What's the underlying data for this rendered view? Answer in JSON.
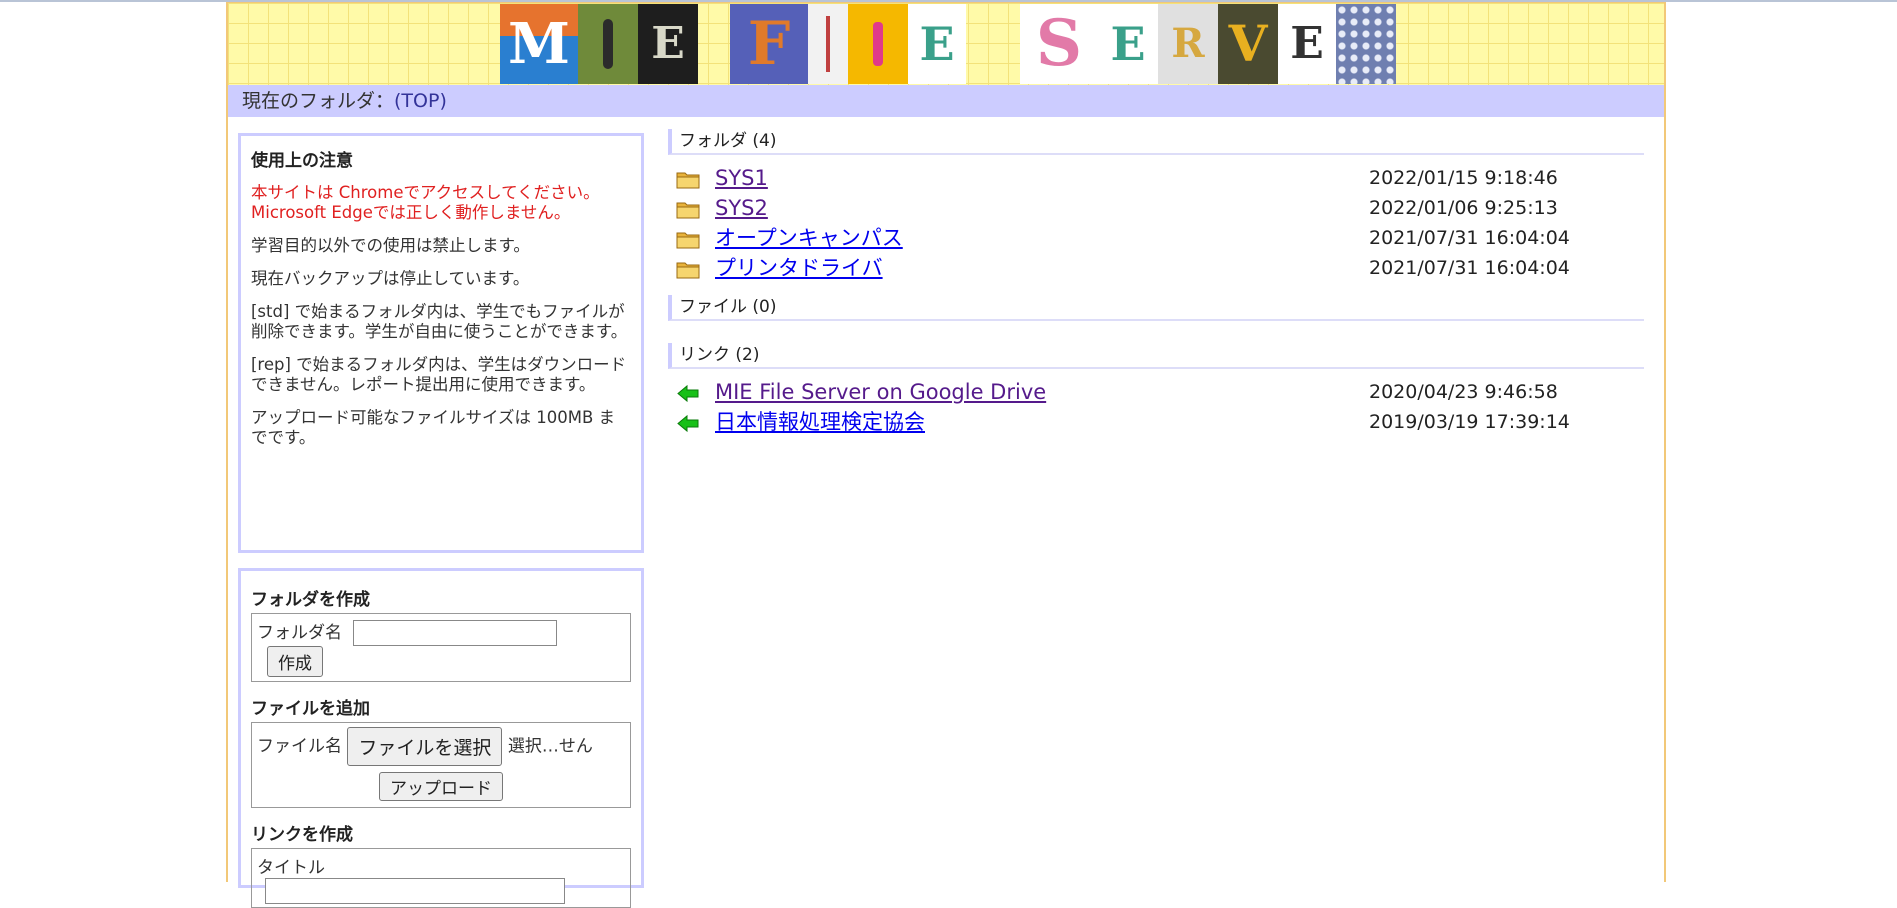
{
  "banner": {
    "tiles": [
      "M",
      "",
      "E",
      "F",
      "",
      "",
      "E",
      "S",
      "E",
      "R",
      "V",
      "E",
      ""
    ]
  },
  "path": {
    "label": "現在のフォルダ：",
    "current": "(TOP)"
  },
  "notes": {
    "title": "使用上の注意",
    "warning": "本サイトは Chromeでアクセスしてください。Microsoft Edgeでは正しく動作しません。",
    "lines": [
      "学習目的以外での使用は禁止します。",
      "現在バックアップは停止しています。",
      "[std] で始まるフォルダ内は、学生でもファイルが削除できます。学生が自由に使うことができます。",
      "[rep] で始まるフォルダ内は、学生はダウンロードできません。レポート提出用に使用できます。",
      "アップロード可能なファイルサイズは 100MB までです。"
    ]
  },
  "forms": {
    "create_folder": {
      "title": "フォルダを作成",
      "field_label": "フォルダ名",
      "value": "",
      "button": "作成"
    },
    "add_file": {
      "title": "ファイルを追加",
      "field_label": "ファイル名",
      "choose_button": "ファイルを選択",
      "status": "選択…せん",
      "upload_button": "アップロード"
    },
    "create_link": {
      "title": "リンクを作成",
      "title_label": "タイトル",
      "value": ""
    }
  },
  "sections": {
    "folders": {
      "label": "フォルダ",
      "count": "(4)"
    },
    "files": {
      "label": "ファイル",
      "count": "(0)"
    },
    "links": {
      "label": "リンク",
      "count": "(2)"
    }
  },
  "folders": [
    {
      "name": "SYS1",
      "date": "2022/01/15 9:18:46",
      "visited": true
    },
    {
      "name": "SYS2",
      "date": "2022/01/06 9:25:13",
      "visited": true
    },
    {
      "name": "オープンキャンパス",
      "date": "2021/07/31 16:04:04",
      "visited": false
    },
    {
      "name": "プリンタドライバ",
      "date": "2021/07/31 16:04:04",
      "visited": false
    }
  ],
  "links": [
    {
      "name": "MIE File Server on Google Drive",
      "date": "2020/04/23 9:46:58",
      "visited": true
    },
    {
      "name": "日本情報処理検定協会",
      "date": "2019/03/19 17:39:14",
      "visited": false
    }
  ],
  "colors": {
    "banner_bg": "#fffaa8",
    "pathbar_bg": "#ccccff",
    "link": "#0000ee",
    "visited": "#551a8b",
    "warning": "#e02020"
  },
  "icons": {
    "folder": "folder-icon",
    "link": "green-arrow-left-icon"
  }
}
